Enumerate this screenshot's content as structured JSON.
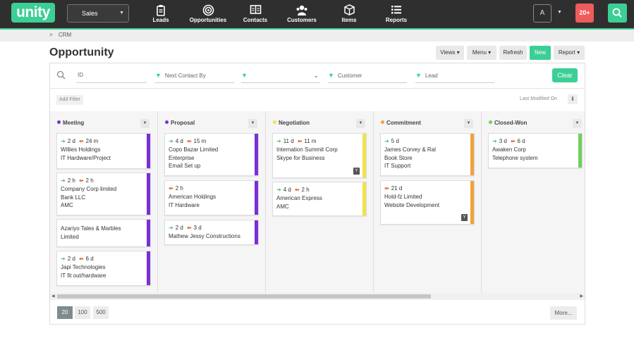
{
  "app": {
    "logo": "unity",
    "instance": "Sales"
  },
  "nav": [
    {
      "label": "Leads",
      "icon": "clipboard-icon"
    },
    {
      "label": "Opportunities",
      "icon": "target-icon"
    },
    {
      "label": "Contacts",
      "icon": "address-book-icon"
    },
    {
      "label": "Customers",
      "icon": "people-icon"
    },
    {
      "label": "Items",
      "icon": "box-icon"
    },
    {
      "label": "Reports",
      "icon": "list-icon"
    }
  ],
  "user": {
    "avatar": "A",
    "notifications": "20+"
  },
  "breadcrumb": {
    "sep": ">",
    "item": "CRM"
  },
  "page": {
    "title": "Opportunity"
  },
  "toolbar": {
    "views": "Views ▾",
    "menu": "Menu ▾",
    "refresh": "Refresh",
    "new": "New",
    "report": "Report ▾"
  },
  "filters": {
    "id": "ID",
    "next_contact": "Next Contact By",
    "blank": "",
    "customer": "Customer",
    "lead": "Lead",
    "clear": "Clear",
    "add_filter": "Add Filter",
    "sort_label": "Last Modified On"
  },
  "colors": {
    "accent": "#3ccf95",
    "danger": "#ef5b5b",
    "purple": "#7b2fd6",
    "yellow": "#f2e24b",
    "orange": "#f0a23b",
    "green": "#70cf5c"
  },
  "columns": [
    {
      "title": "Meeting",
      "dot": "#7b2fd6",
      "bar": "#7b2fd6",
      "cards": [
        {
          "g": "2 d",
          "r": "24 m",
          "lines": [
            "Willies Holdings",
            "IT Hardware/Project"
          ]
        },
        {
          "g": "2 h",
          "r": "2 h",
          "lines": [
            "Company Corp limited",
            "Bank LLC",
            "AMC"
          ]
        },
        {
          "g": "",
          "r": "",
          "lines": [
            "Azariyo Tales & Marbles",
            "Limited"
          ]
        },
        {
          "g": "2 d",
          "r": "6 d",
          "lines": [
            "Japi Technologies",
            "IT fit out/hardware"
          ]
        }
      ]
    },
    {
      "title": "Proposal",
      "dot": "#7b2fd6",
      "bar": "#7b2fd6",
      "cards": [
        {
          "g": "4 d",
          "r": "15 m",
          "lines": [
            "Copo Bazar Limited",
            "Enterprise",
            "Email Set up"
          ]
        },
        {
          "g": "",
          "r": "2 h",
          "lines": [
            "American Holdings",
            "IT Hardware"
          ]
        },
        {
          "g": "2 d",
          "r": "3 d",
          "lines": [
            "Mathew Jessy Constructions"
          ]
        }
      ]
    },
    {
      "title": "Negotiation",
      "dot": "#f2e24b",
      "bar": "#f2e24b",
      "cards": [
        {
          "g": "11 d",
          "r": "11 m",
          "lines": [
            "Internation Summit Corp",
            "Skype for Business"
          ],
          "badge": "Y"
        },
        {
          "g": "4 d",
          "r": "2 h",
          "lines": [
            "American Express",
            "AMC"
          ]
        }
      ]
    },
    {
      "title": "Commitment",
      "dot": "#f0a23b",
      "bar": "#f0a23b",
      "cards": [
        {
          "g": "5 d",
          "r": "",
          "lines": [
            "James Corvey & Ral",
            "Book Store",
            "IT Support"
          ]
        },
        {
          "g": "",
          "r": "21 d",
          "lines": [
            "Hold-fz Limited",
            "Website Development"
          ],
          "badge": "Y"
        }
      ]
    },
    {
      "title": "Closed-Won",
      "dot": "#70cf5c",
      "bar": "#70cf5c",
      "cards": [
        {
          "g": "3 d",
          "r": "6 d",
          "lines": [
            "Awaken Corp",
            "Telephone system"
          ]
        }
      ]
    }
  ],
  "pagination": {
    "sizes": [
      "20",
      "100",
      "500"
    ],
    "more": "More..."
  }
}
